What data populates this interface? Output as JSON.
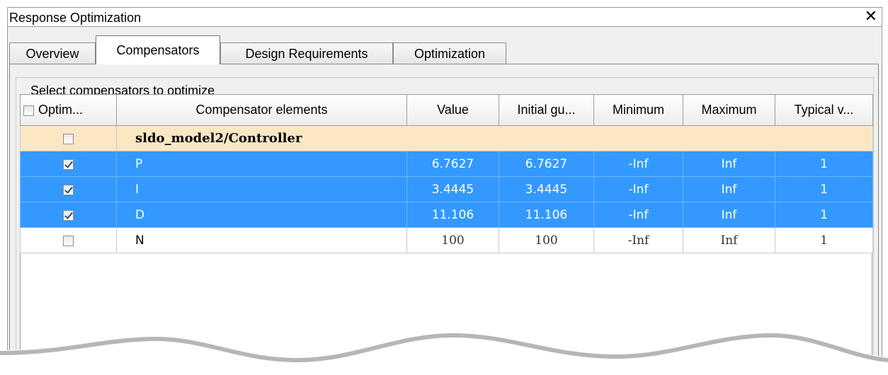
{
  "window": {
    "title": "Response Optimization",
    "close_glyph": "✕"
  },
  "tabs": [
    {
      "label": "Overview",
      "active": false
    },
    {
      "label": "Compensators",
      "active": true
    },
    {
      "label": "Design Requirements",
      "active": false
    },
    {
      "label": "Optimization",
      "active": false
    }
  ],
  "group": {
    "label": "Select compensators to optimize"
  },
  "table": {
    "columns": [
      "Optim...",
      "Compensator elements",
      "Value",
      "Initial gu...",
      "Minimum",
      "Maximum",
      "Typical v..."
    ],
    "header_checked": false,
    "group_row": {
      "name": "sldo_model2/Controller",
      "checked": false
    },
    "rows": [
      {
        "checked": true,
        "name": "P",
        "value": "6.7627",
        "initial": "6.7627",
        "min": "-Inf",
        "max": "Inf",
        "typical": "1",
        "selected": true
      },
      {
        "checked": true,
        "name": "I",
        "value": "3.4445",
        "initial": "3.4445",
        "min": "-Inf",
        "max": "Inf",
        "typical": "1",
        "selected": true
      },
      {
        "checked": true,
        "name": "D",
        "value": "11.106",
        "initial": "11.106",
        "min": "-Inf",
        "max": "Inf",
        "typical": "1",
        "selected": true
      },
      {
        "checked": false,
        "name": "N",
        "value": "100",
        "initial": "100",
        "min": "-Inf",
        "max": "Inf",
        "typical": "1",
        "selected": false
      }
    ]
  },
  "colors": {
    "selection": "#3399ff",
    "group_row": "#fce7c3"
  }
}
